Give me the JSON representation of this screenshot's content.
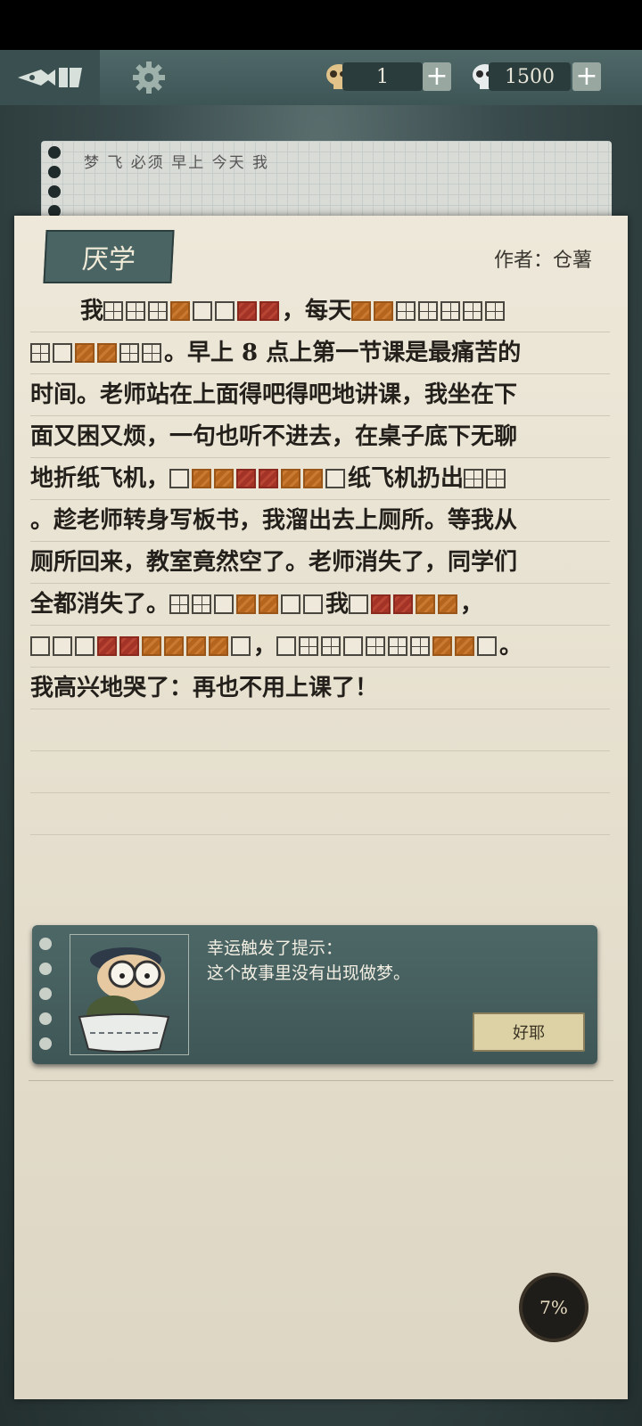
{
  "hud": {
    "back_icon": "quill-back-icon",
    "settings_icon": "gear-icon",
    "hint_count": "1",
    "coin_count": "1500",
    "plus": "+"
  },
  "clue_sheet": {
    "words": "梦 飞 必须 早上 今天 我"
  },
  "story": {
    "title": "厌学",
    "author": "作者：仓薯",
    "lines": [
      [
        [
          "t",
          "我 "
        ],
        [
          "g"
        ],
        [
          "g"
        ],
        [
          "g"
        ],
        [
          "o"
        ],
        [
          "b"
        ],
        [
          "b"
        ],
        [
          "r"
        ],
        [
          "r"
        ],
        [
          "t",
          "，每天 "
        ],
        [
          "o"
        ],
        [
          "o"
        ],
        [
          "g"
        ],
        [
          "g"
        ],
        [
          "g"
        ],
        [
          "g"
        ],
        [
          "g"
        ]
      ],
      [
        [
          "g"
        ],
        [
          "b"
        ],
        [
          "o"
        ],
        [
          "o"
        ],
        [
          "g"
        ],
        [
          "g"
        ],
        [
          "t",
          "。早上 8 点上第一节课是最痛苦的"
        ]
      ],
      [
        [
          "t",
          "时间。老师站在上面得吧得吧地讲课，我坐在下"
        ]
      ],
      [
        [
          "t",
          "面又困又烦，一句也听不进去，在桌子底下无聊"
        ]
      ],
      [
        [
          "t",
          "地折纸飞机，"
        ],
        [
          "b"
        ],
        [
          "o"
        ],
        [
          "o"
        ],
        [
          "r"
        ],
        [
          "r"
        ],
        [
          "o"
        ],
        [
          "o"
        ],
        [
          "b"
        ],
        [
          "t",
          "纸飞机扔出 "
        ],
        [
          "g"
        ],
        [
          "g"
        ]
      ],
      [
        [
          "t",
          "。趁老师转身写板书，我溜出去上厕所。等我从"
        ]
      ],
      [
        [
          "t",
          "厕所回来，教室竟然空了。老师消失了，同学们"
        ]
      ],
      [
        [
          "t",
          "全都消失了。"
        ],
        [
          "g"
        ],
        [
          "g"
        ],
        [
          "b"
        ],
        [
          "o"
        ],
        [
          "o"
        ],
        [
          "b"
        ],
        [
          "b"
        ],
        [
          "t",
          "我 "
        ],
        [
          "b"
        ],
        [
          "r"
        ],
        [
          "r"
        ],
        [
          "o"
        ],
        [
          "o"
        ],
        [
          "t",
          "，"
        ]
      ],
      [
        [
          "b"
        ],
        [
          "b"
        ],
        [
          "b"
        ],
        [
          "r"
        ],
        [
          "r"
        ],
        [
          "o"
        ],
        [
          "o"
        ],
        [
          "o"
        ],
        [
          "o"
        ],
        [
          "b"
        ],
        [
          "t",
          "，"
        ],
        [
          "b"
        ],
        [
          "g"
        ],
        [
          "g"
        ],
        [
          "b"
        ],
        [
          "g"
        ],
        [
          "g"
        ],
        [
          "g"
        ],
        [
          "o"
        ],
        [
          "o"
        ],
        [
          "b"
        ],
        [
          "t",
          "。"
        ]
      ],
      [
        [
          "t",
          "我高兴地哭了：再也不用上课了！"
        ]
      ]
    ]
  },
  "hint": {
    "line1": "幸运触发了提示：",
    "line2": "这个故事里没有出现做梦。",
    "ok_label": "好耶"
  },
  "progress": {
    "label": "7%",
    "value": 0.07
  }
}
